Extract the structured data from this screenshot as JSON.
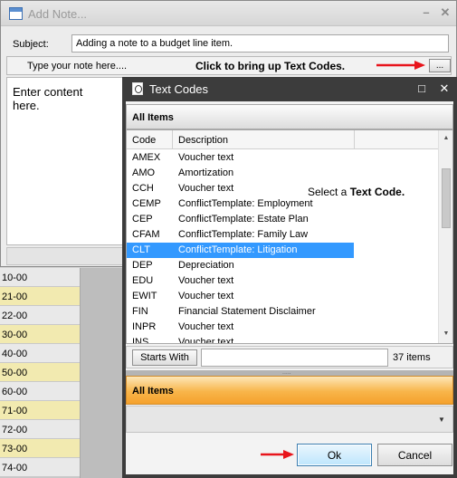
{
  "add_note": {
    "title": "Add Note...",
    "minimize": "–",
    "close": "✕",
    "subject_label": "Subject:",
    "subject_value": "Adding a note to a budget line item.",
    "note_hint": "Type your note here....",
    "callout": "Click to bring up Text Codes.",
    "ellipsis_label": "...",
    "body_placeholder": "Enter content here."
  },
  "background_rows": [
    "10-00",
    "21-00",
    "22-00",
    "30-00",
    "40-00",
    "50-00",
    "60-00",
    "71-00",
    "72-00",
    "73-00",
    "74-00"
  ],
  "text_codes": {
    "title": "Text Codes",
    "maximize": "□",
    "close": "✕",
    "header": "All Items",
    "columns": {
      "code": "Code",
      "description": "Description"
    },
    "rows": [
      {
        "code": "AMEX",
        "description": "Voucher text"
      },
      {
        "code": "AMO",
        "description": "Amortization"
      },
      {
        "code": "CCH",
        "description": "Voucher text"
      },
      {
        "code": "CEMP",
        "description": "ConflictTemplate: Employment"
      },
      {
        "code": "CEP",
        "description": "ConflictTemplate: Estate Plan"
      },
      {
        "code": "CFAM",
        "description": "ConflictTemplate: Family Law"
      },
      {
        "code": "CLT",
        "description": "ConflictTemplate: Litigation",
        "selected": true
      },
      {
        "code": "DEP",
        "description": "Depreciation"
      },
      {
        "code": "EDU",
        "description": "Voucher text"
      },
      {
        "code": "EWIT",
        "description": "Voucher text"
      },
      {
        "code": "FIN",
        "description": "Financial Statement Disclaimer"
      },
      {
        "code": "INPR",
        "description": "Voucher text"
      },
      {
        "code": "INS",
        "description": "Voucher text"
      }
    ],
    "callout_prefix": "Select a ",
    "callout_bold": "Text Code.",
    "starts_with_label": "Starts With",
    "filter_value": "",
    "item_count": "37 items",
    "splitter_grip": ".....",
    "group_header": "All Items",
    "ok_label": "Ok",
    "cancel_label": "Cancel"
  },
  "colors": {
    "selection": "#3399ff",
    "annotation_arrow": "#e8141b",
    "group_header": "#f8b54a",
    "background_highlight": "#f2eab0"
  }
}
